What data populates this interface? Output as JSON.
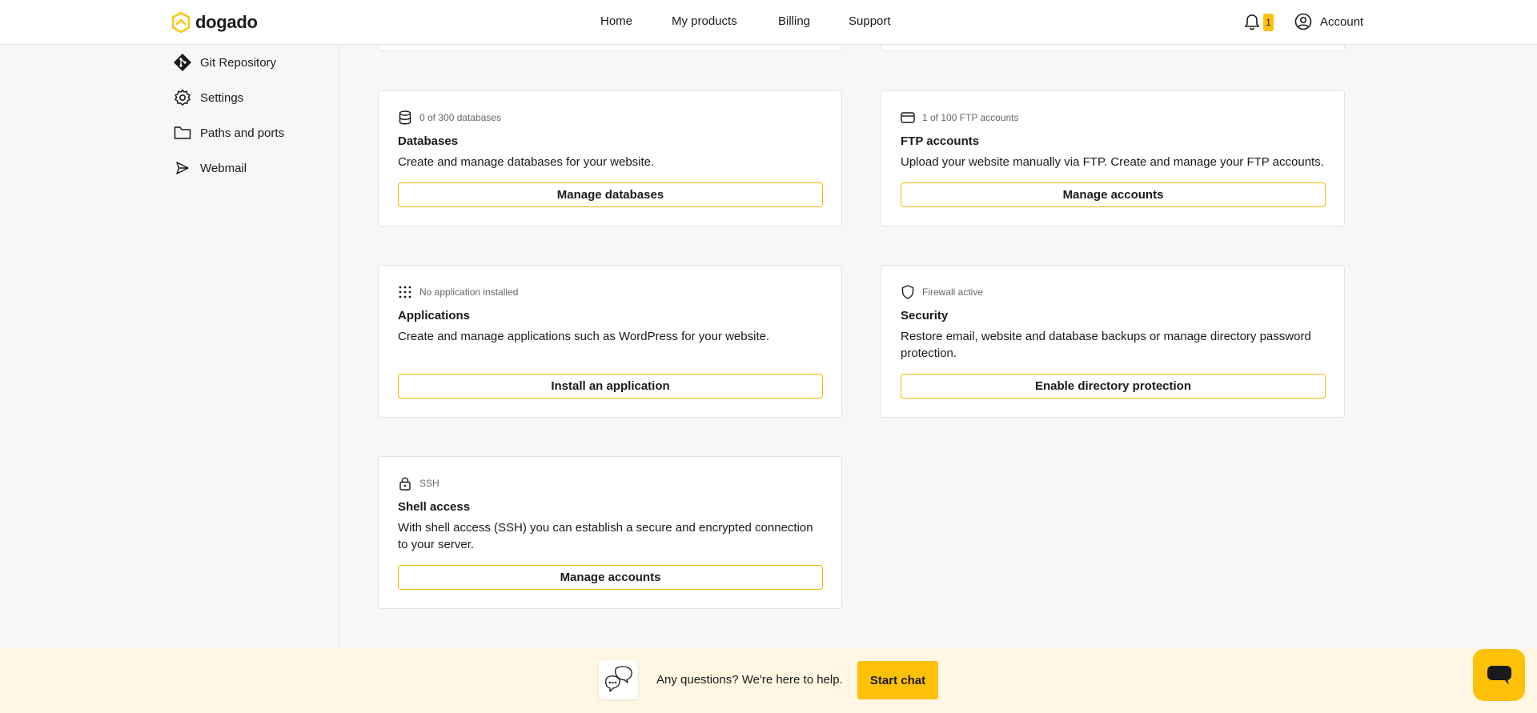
{
  "brand": {
    "name": "dogado",
    "accent": "#ffc107"
  },
  "nav": {
    "items": [
      {
        "label": "Home"
      },
      {
        "label": "My products"
      },
      {
        "label": "Billing"
      },
      {
        "label": "Support"
      }
    ]
  },
  "header": {
    "notification_count": "1",
    "account_label": "Account",
    "icons": {
      "bell": "bell-icon",
      "account": "user-circle-icon"
    }
  },
  "sidebar": {
    "items": [
      {
        "label": "Git Repository",
        "icon": "git-icon"
      },
      {
        "label": "Settings",
        "icon": "gear-icon"
      },
      {
        "label": "Paths and ports",
        "icon": "folder-icon"
      },
      {
        "label": "Webmail",
        "icon": "send-icon"
      }
    ]
  },
  "cards": {
    "databases": {
      "meta": "0 of 300 databases",
      "icon": "database-icon",
      "title": "Databases",
      "desc": "Create and manage databases for your website.",
      "button": "Manage databases"
    },
    "ftp": {
      "meta": "1 of 100 FTP accounts",
      "icon": "credit-card-icon",
      "title": "FTP accounts",
      "desc": "Upload your website manually via FTP. Create and manage your FTP accounts.",
      "button": "Manage accounts"
    },
    "applications": {
      "meta": "No application installed",
      "icon": "grid-icon",
      "title": "Applications",
      "desc": "Create and manage applications such as WordPress for your website.",
      "button": "Install an application"
    },
    "security": {
      "meta": "Firewall active",
      "icon": "shield-icon",
      "title": "Security",
      "desc": "Restore email, website and database backups or manage directory password protection.",
      "button": "Enable directory protection"
    },
    "ssh": {
      "meta": "SSH",
      "icon": "lock-icon",
      "title": "Shell access",
      "desc": "With shell access (SSH) you can establish a secure and encrypted connection to your server.",
      "button": "Manage accounts"
    }
  },
  "help": {
    "text": "Any questions? We're here to help.",
    "button": "Start chat"
  }
}
